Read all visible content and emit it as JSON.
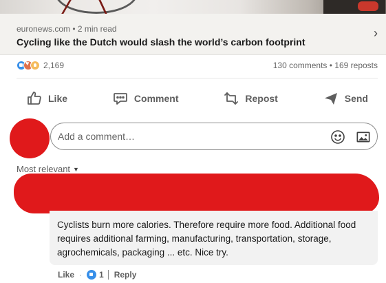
{
  "article": {
    "source": "euronews.com • 2 min read",
    "title": "Cycling like the Dutch would slash the world’s carbon footprint",
    "chevron_icon": "chevron-right-icon"
  },
  "social": {
    "reaction_icons": [
      "like-icon",
      "love-icon",
      "insightful-icon"
    ],
    "reaction_count": "2,169",
    "comments_reposts": "130 comments • 169 reposts"
  },
  "actions": {
    "like": "Like",
    "comment": "Comment",
    "repost": "Repost",
    "send": "Send"
  },
  "comment_input": {
    "placeholder": "Add a comment…"
  },
  "sort": {
    "label": "Most relevant"
  },
  "comment": {
    "text": "Cyclists burn more calories. Therefore require more food. Additional food requires additional farming, manufacturing, transportation, storage, agrochemicals, packaging ... etc. Nice try.",
    "like_label": "Like",
    "like_count": "1",
    "reply_label": "Reply"
  },
  "colors": {
    "redaction": "#e0191b",
    "like_blue": "#378fe9",
    "article_bg": "#f3f2ef",
    "comment_bg": "#f2f2f2"
  }
}
